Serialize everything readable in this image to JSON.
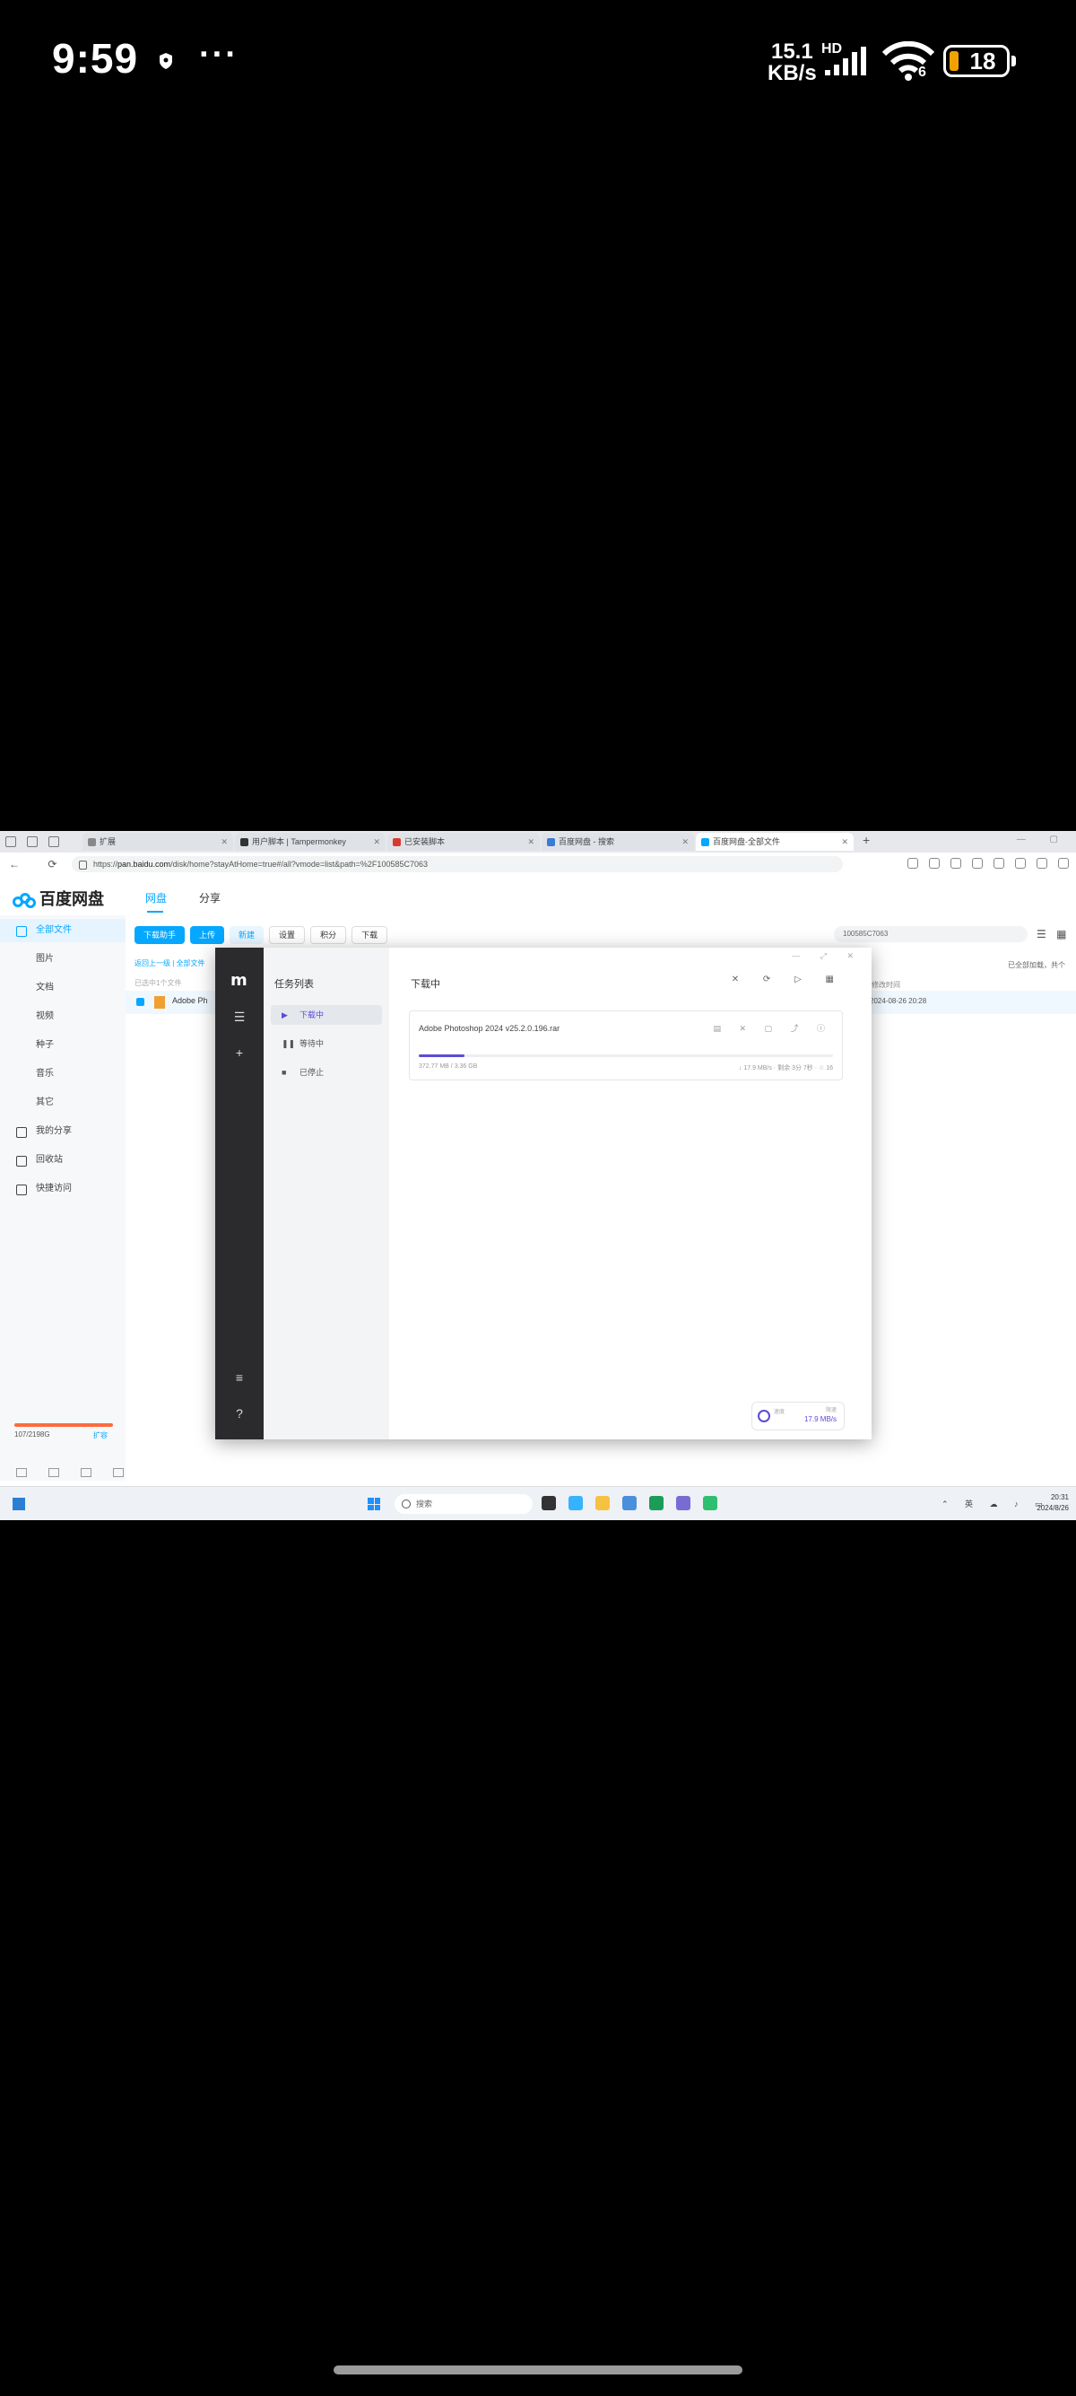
{
  "status_bar": {
    "time": "9:59",
    "more": "···",
    "net_speed_value": "15.1",
    "net_speed_unit": "KB/s",
    "network_type": "HD",
    "wifi_version": "6",
    "battery": "18",
    "battery_color": "#f2a200"
  },
  "browser": {
    "tabs": [
      {
        "label": "扩展",
        "favicon_color": "#888888"
      },
      {
        "label": "用户脚本 | Tampermonkey",
        "favicon_color": "#333333"
      },
      {
        "label": "已安装脚本",
        "favicon_color": "#d63b2f"
      },
      {
        "label": "百度网盘 - 搜索",
        "favicon_color": "#3a7bd5"
      },
      {
        "label": "百度网盘-全部文件",
        "favicon_color": "#06a7ff"
      }
    ],
    "new_tab": "+",
    "url_host": "pan.baidu.com",
    "url_prefix": "https://",
    "url_rest": "/disk/home?stayAtHome=true#/all?vmode=list&path=%2F100585C7063"
  },
  "baidu": {
    "logo_text": "百度网盘",
    "nav_main": "网盘",
    "nav_share": "分享",
    "sidebar": [
      {
        "label": "全部文件"
      },
      {
        "label": "图片"
      },
      {
        "label": "文档"
      },
      {
        "label": "视频"
      },
      {
        "label": "种子"
      },
      {
        "label": "音乐"
      },
      {
        "label": "其它"
      },
      {
        "label": "我的分享"
      },
      {
        "label": "回收站"
      },
      {
        "label": "快捷访问"
      }
    ],
    "quota_text": "107/2198G",
    "quota_expand": "扩容",
    "toolbar": {
      "download_btn": "下载助手",
      "upload_btn": "上传",
      "new_btn": "新建",
      "settings_btn": "设置",
      "points_btn": "积分",
      "download2_btn": "下载"
    },
    "search_value": "100585C7063",
    "breadcrumb": "返回上一级 | 全部文件",
    "list_header": "已选中1个文件",
    "file_row_name": "Adobe Ph",
    "file_row_date": "2024-08-26 20:28",
    "right_info": "已全部加载，共个",
    "right_col": "修改时间"
  },
  "download_manager": {
    "logo": "m",
    "list_title": "任务列表",
    "items": [
      {
        "label": "下载中",
        "icon": "▶"
      },
      {
        "label": "等待中",
        "icon": "❚❚"
      },
      {
        "label": "已停止",
        "icon": "■"
      }
    ],
    "main_title": "下载中",
    "task": {
      "name": "Adobe Photoshop 2024 v25.2.0.196.rar",
      "progress": 0.11,
      "size_text": "372.77 MB / 3.36 GB",
      "meta_text": "↓ 17.9 MB/s · 剩余 3分 7秒 · ☆ 16"
    },
    "speed_caption": "限速",
    "speed_label": "速度",
    "speed_value": "17.9 MB/s",
    "accent": "#5b4bd9"
  },
  "taskbar": {
    "search_placeholder": "搜索",
    "tray": "⌃ 英 ☁ ♪ ▭",
    "clock_time": "20:31",
    "clock_date": "2024/8/26"
  }
}
